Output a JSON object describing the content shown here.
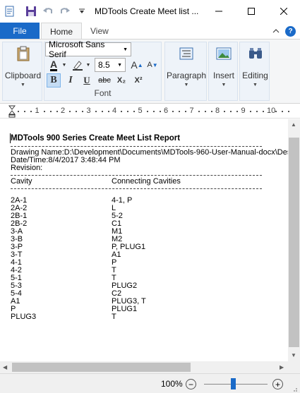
{
  "window": {
    "title": "MDTools Create Meet list ..."
  },
  "tabs": {
    "file": "File",
    "home": "Home",
    "view": "View",
    "help": "?"
  },
  "ribbon": {
    "clipboard": "Clipboard",
    "font_group": "Font",
    "font_name": "Microsoft Sans Serif",
    "font_size": "8.5",
    "paragraph": "Paragraph",
    "insert": "Insert",
    "editing": "Editing",
    "bold": "B",
    "italic": "I",
    "underline": "U",
    "strike": "abc",
    "subscript": "X₂",
    "superscript": "X²",
    "grow": "A",
    "shrink": "A",
    "font_color": "A"
  },
  "ruler": {
    "numbers": [
      "1",
      "2",
      "3",
      "4",
      "5",
      "6",
      "7",
      "8",
      "9",
      "10"
    ]
  },
  "document": {
    "title": "MDTools 900 Series Create Meet List Report",
    "drawing_name": "Drawing Name:D:\\Development\\Documents\\MDTools-960-User-Manual-docx\\Des",
    "date_time": "Date/Time:8/4/2017 3:48:44 PM",
    "revision": "Revision:",
    "headers": [
      "Cavity",
      "Connecting Cavities"
    ],
    "rows": [
      [
        "2A-1",
        "4-1, P"
      ],
      [
        "2A-2",
        "L"
      ],
      [
        "2B-1",
        "5-2"
      ],
      [
        "2B-2",
        "C1"
      ],
      [
        "3-A",
        "M1"
      ],
      [
        "3-B",
        "M2"
      ],
      [
        "3-P",
        "P, PLUG1"
      ],
      [
        "3-T",
        "A1"
      ],
      [
        "4-1",
        "P"
      ],
      [
        "4-2",
        "T"
      ],
      [
        "5-1",
        "T"
      ],
      [
        "5-3",
        "PLUG2"
      ],
      [
        "5-4",
        "C2"
      ],
      [
        "A1",
        "PLUG3, T"
      ],
      [
        "P",
        "PLUG1"
      ],
      [
        "PLUG3",
        "T"
      ]
    ]
  },
  "status": {
    "zoom": "100%",
    "zoom_minus": "−",
    "zoom_plus": "+",
    "zoom_level": 0.45
  },
  "colors": {
    "accent": "#1a6ac8"
  }
}
